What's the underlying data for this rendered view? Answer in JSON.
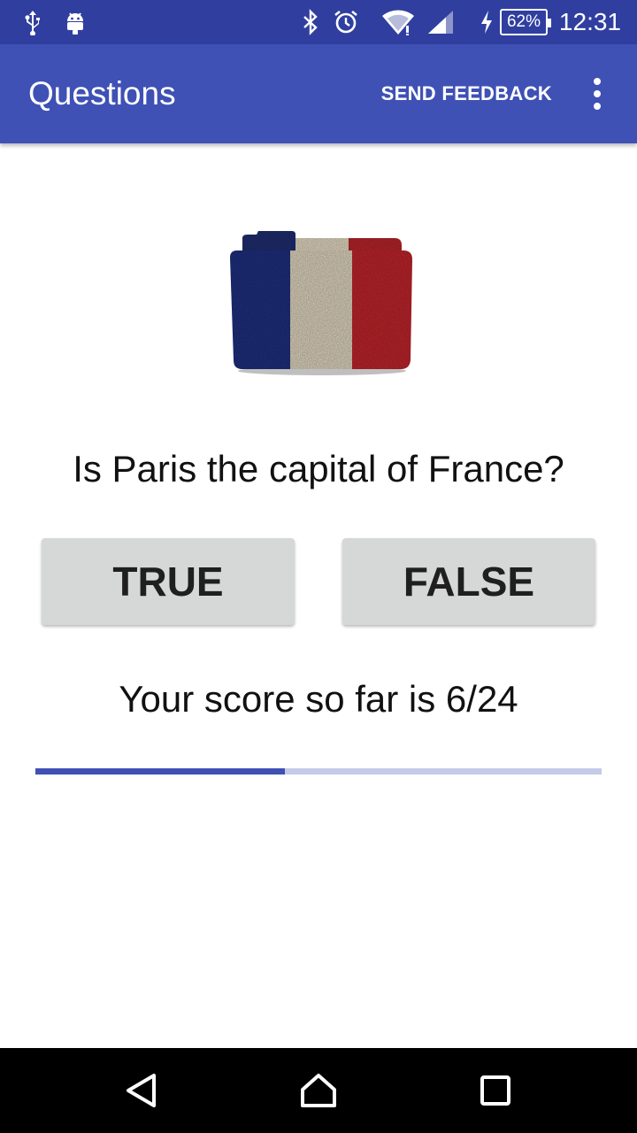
{
  "status_bar": {
    "battery_percent": "62%",
    "time": "12:31",
    "icons": [
      "usb-icon",
      "android-debug-icon",
      "bluetooth-icon",
      "alarm-icon",
      "wifi-icon",
      "cell-signal-icon",
      "charging-icon",
      "battery-icon"
    ]
  },
  "app_bar": {
    "title": "Questions",
    "action_label": "SEND FEEDBACK",
    "overflow_icon": "more-vert-icon",
    "color": "#3f51b5",
    "status_color": "#303f9f"
  },
  "quiz": {
    "question": "Is Paris the capital of France?",
    "true_label": "TRUE",
    "false_label": "FALSE",
    "score_text": "Your score so far is 6/24",
    "progress_fraction": 0.44,
    "image_icon": "france-flag-folder-icon"
  },
  "nav_bar": {
    "icons": [
      "back-icon",
      "home-icon",
      "recents-icon"
    ]
  }
}
